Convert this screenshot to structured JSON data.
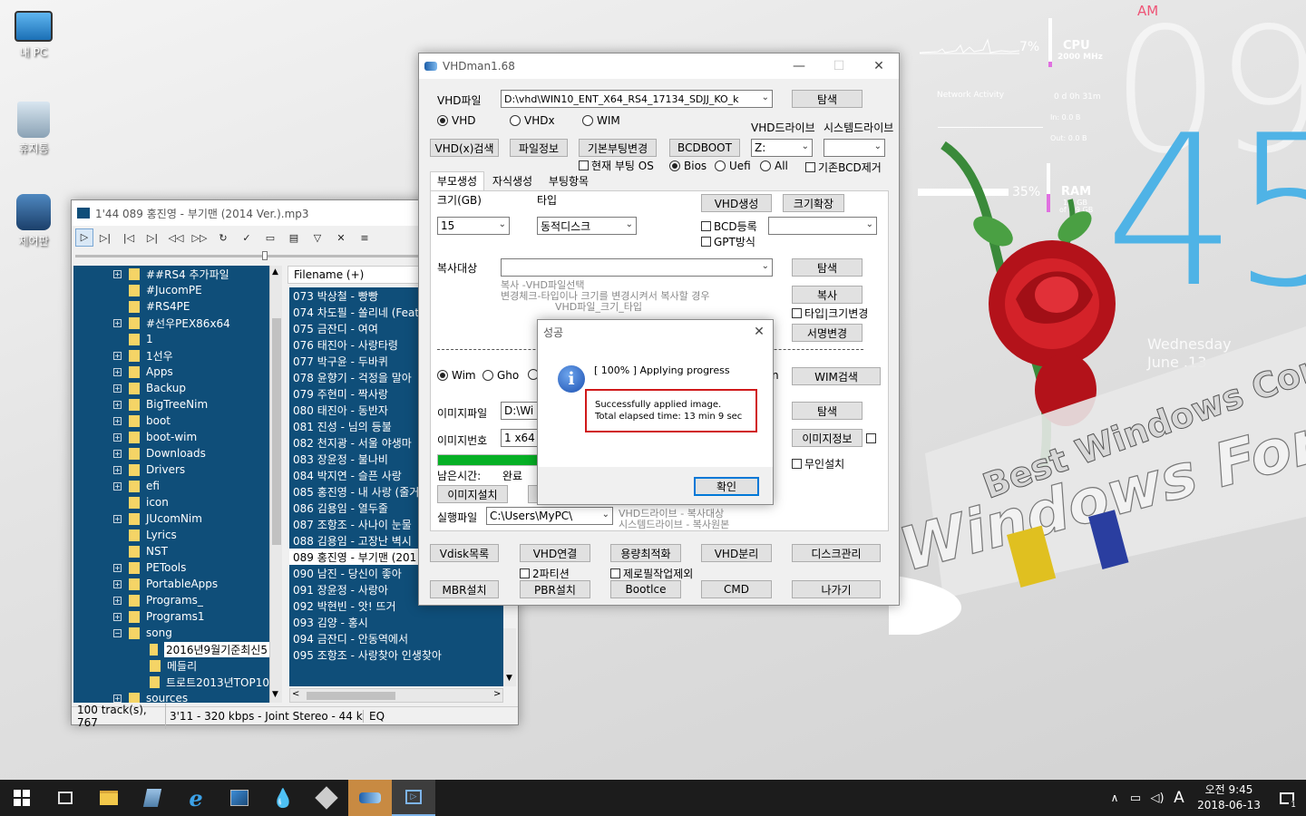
{
  "desktop": {
    "icons": [
      {
        "label": "내 PC",
        "icon": "computer-icon"
      },
      {
        "label": "휴지통",
        "icon": "recycle-bin-icon"
      },
      {
        "label": "제어판",
        "icon": "control-panel-icon"
      }
    ],
    "widgets": {
      "cpu_percent": "7%",
      "cpu_label": "CPU",
      "cpu_freq": "2000 MHz",
      "network_label": "Network Activity",
      "uptime": "0 d 0h 31m",
      "net_in": "In: 0.0 B",
      "net_out": "Out: 0.0 B",
      "ram_percent": "35%",
      "ram_label": "RAM",
      "ram_used": "1.4 GB",
      "ram_total": "of 3.9 GB",
      "ampm": "AM",
      "hour": "09",
      "minute": "45",
      "weekday": "Wednesday",
      "date": "June .13"
    },
    "colors": {
      "clock": "#4fb3e6",
      "rose": "#c8161d",
      "taskbar": "#1c1c1c"
    }
  },
  "player": {
    "title": "1'44 089 홍진영 - 부기맨 (2014 Ver.).mp3",
    "tree": [
      {
        "label": "##RS4 추가파일",
        "exp": "+"
      },
      {
        "label": "#JucomPE",
        "exp": ""
      },
      {
        "label": "#RS4PE",
        "exp": ""
      },
      {
        "label": "#선우PEX86x64",
        "exp": "+"
      },
      {
        "label": "1",
        "exp": ""
      },
      {
        "label": "1선우",
        "exp": "+"
      },
      {
        "label": "Apps",
        "exp": "+"
      },
      {
        "label": "Backup",
        "exp": "+"
      },
      {
        "label": "BigTreeNim",
        "exp": "+"
      },
      {
        "label": "boot",
        "exp": "+"
      },
      {
        "label": "boot-wim",
        "exp": "+"
      },
      {
        "label": "Downloads",
        "exp": "+"
      },
      {
        "label": "Drivers",
        "exp": "+"
      },
      {
        "label": "efi",
        "exp": "+"
      },
      {
        "label": "icon",
        "exp": ""
      },
      {
        "label": "JUcomNim",
        "exp": "+"
      },
      {
        "label": "Lyrics",
        "exp": ""
      },
      {
        "label": "NST",
        "exp": ""
      },
      {
        "label": "PETools",
        "exp": "+"
      },
      {
        "label": "PortableApps",
        "exp": "+"
      },
      {
        "label": "Programs_",
        "exp": "+"
      },
      {
        "label": "Programs1",
        "exp": "+"
      },
      {
        "label": "song",
        "exp": "−"
      }
    ],
    "subtree": [
      "2016년9월기준최신5",
      "메들리",
      "트로트2013년TOP10"
    ],
    "tree_last": "sources",
    "playlist_header": "Filename (+)",
    "playlist": [
      "073 박상철 - 빵빵",
      "074 차도필 - 쏠리네 (Feat",
      "075 금잔디 - 여여",
      "076 태진아 - 사랑타령",
      "077 박구윤 - 두바퀴",
      "078 윤향기 - 걱정을 말아",
      "079 주현미 - 짝사랑",
      "080 태진아 - 동반자",
      "081 진성 - 님의 등불",
      "082 천지광 - 서울 야생마",
      "083 장윤정 - 불나비",
      "084 박지연 - 슬픈 사랑",
      "085 홍진영 - 내 사랑 (줄거",
      "086 김용임 - 열두줄",
      "087 조항조 - 사나이 눈물",
      "088 김용임 - 고장난 벽시",
      "089 홍진영 - 부기맨 (201",
      "090 남진 - 당신이 좋아",
      "091 장윤정 - 사랑아",
      "092 박현빈 - 앗! 뜨거",
      "093 김양 - 홍시",
      "094 금잔디 - 안동역에서",
      "095 조항조 - 사랑찾아 인생찾아"
    ],
    "selected_index": 16,
    "status": "100 track(s), 767",
    "status2": "3'11 - 320 kbps - Joint Stereo - 44 kHz",
    "status_eq": "EQ"
  },
  "vhd": {
    "title": "VHDman1.68",
    "vhd_file_label": "VHD파일",
    "vhd_file_value": "D:\\vhd\\WIN10_ENT_X64_RS4_17134_SDJJ_KO_k",
    "browse": "탐색",
    "radio_vhd": "VHD",
    "radio_vhdx": "VHDx",
    "radio_wim": "WIM",
    "vhd_drive_label": "VHD드라이브",
    "sys_drive_label": "시스템드라이브",
    "btn_search": "VHD(x)검색",
    "btn_fileinfo": "파일정보",
    "btn_bootchange": "기본부팅변경",
    "btn_bcdboot": "BCDBOOT",
    "drive_value": "Z:",
    "chk_current_boot": "현재 부팅 OS",
    "rad_bios": "Bios",
    "rad_uefi": "Uefi",
    "rad_all": "All",
    "chk_remove_bcd": "기존BCD제거",
    "tabs": [
      "부모생성",
      "자식생성",
      "부팅항목"
    ],
    "size_label": "크기(GB)",
    "type_label": "타입",
    "btn_create": "VHD생성",
    "btn_extend": "크기확장",
    "size_value": "15",
    "type_value": "동적디스크",
    "chk_bcd": "BCD등록",
    "chk_gpt": "GPT방식",
    "copy_target_label": "복사대상",
    "hint1": "복사       -VHD파일선택",
    "hint2": "변경체크-타입이나  크기를 변경시켜서 복사할 경우",
    "hint3": "VHD파일_크기_타입",
    "btn_copy": "복사",
    "chk_type_size": "타입|크기변경",
    "btn_sign": "서명변경",
    "rad_wim": "Wim",
    "rad_gho": "Gho",
    "partial_n": "n",
    "btn_wim_search": "WIM검색",
    "image_file_label": "이미지파일",
    "image_file_value": "D:\\Wi",
    "image_num_label": "이미지번호",
    "image_num_value": "1  x64",
    "btn_image_info": "이미지정보",
    "chk_unattend": "무인설치",
    "remain_label": "남은시간:",
    "remain_value": "완료",
    "btn_image_install": "이미지설치",
    "exec_label": "실행파일",
    "exec_value": "C:\\Users\\MyPC\\",
    "hint4": "VHD드라이브 - 복사대상",
    "hint5": "시스템드라이브 - 복사원본",
    "progress": 1.0,
    "bottom_row1": [
      "Vdisk목록",
      "VHD연결",
      "용량최적화",
      "VHD분리",
      "디스크관리"
    ],
    "chk_2partition": "2파티션",
    "chk_zero_exclude": "제로필작업제외",
    "bottom_row2": [
      "MBR설치",
      "PBR설치",
      "Bootlce",
      "CMD",
      "나가기"
    ]
  },
  "dialog": {
    "title": "성공",
    "progress_text": "[ 100% ] Applying progress",
    "msg1": "Successfully applied image.",
    "msg2": "Total elapsed time: 13 min 9 sec",
    "ok": "확인"
  },
  "taskbar": {
    "time": "오전 9:45",
    "date": "2018-06-13",
    "ime": "A",
    "notify_count": "1"
  }
}
